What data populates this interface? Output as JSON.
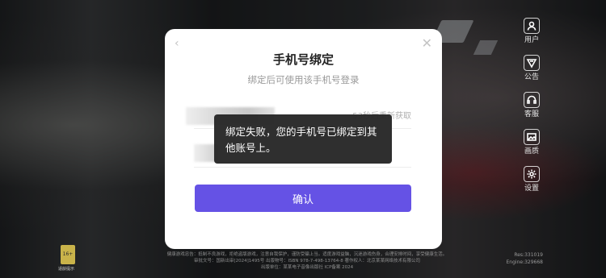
{
  "dialog": {
    "back_icon": "‹",
    "close_icon": "✕",
    "title": "手机号绑定",
    "subtitle": "绑定后可使用该手机号登录",
    "resend": "53秒后重新获取",
    "confirm": "确认"
  },
  "toast": {
    "message": "绑定失败，您的手机号已绑定到其他账号上。"
  },
  "side_menu": [
    {
      "label": "用户",
      "icon": "user-icon"
    },
    {
      "label": "公告",
      "icon": "announcement-icon"
    },
    {
      "label": "客服",
      "icon": "headset-icon"
    },
    {
      "label": "画质",
      "icon": "image-quality-icon"
    },
    {
      "label": "设置",
      "icon": "settings-icon"
    }
  ],
  "age_badge": {
    "rating": "16+",
    "caption": "适龄提示"
  },
  "footer": {
    "line1": "健康游戏忠告：抵制不良游戏，拒绝盗版游戏，注意自我保护，谨防受骗上当。适度游戏益脑，沉迷游戏伤身，合理安排时间，享受健康生活。",
    "line2": "审批文号：国新出审[2024]1495号 出版物号：ISBN 978-7-498-13764-8 著作权人：北京某某网络技术有限公司",
    "line3": "出版单位：某某电子音像出版社 ICP备案 2024"
  },
  "version": {
    "res": "Res:331019",
    "engine": "Engine:329668"
  }
}
